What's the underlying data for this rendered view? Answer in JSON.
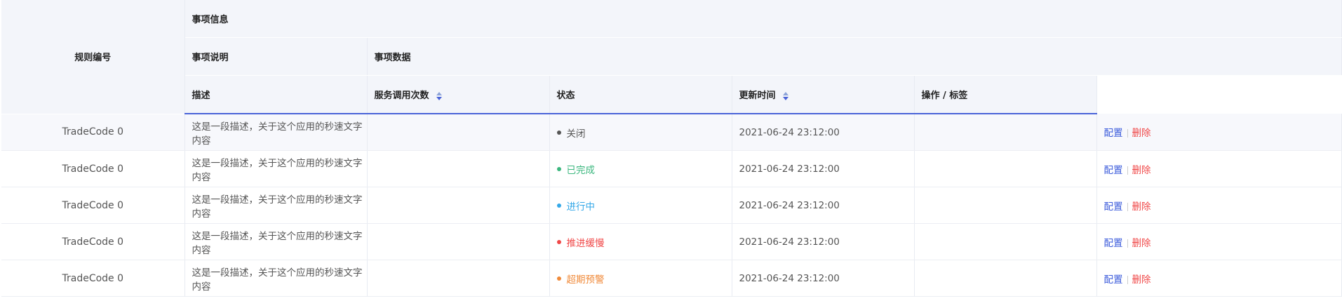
{
  "header": {
    "rule_no": "规则编号",
    "item_info": "事项信息",
    "item_desc_group": "事项说明",
    "item_data_group": "事项数据",
    "desc": "描述",
    "call_count": "服务调用次数",
    "status": "状态",
    "updated_at": "更新时间",
    "actions": "操作 / 标签"
  },
  "colors": {
    "accent": "#4a63d8",
    "link": "#3b5bdb",
    "danger": "#f04848"
  },
  "rows": [
    {
      "code": "TradeCode 0",
      "desc": "这是一段描述，关于这个应用的秒速文字内容",
      "calls": "",
      "status": "关闭",
      "status_color": "#555555",
      "time": "2021-06-24 23:12:00",
      "action_config": "配置",
      "action_delete": "删除"
    },
    {
      "code": "TradeCode 0",
      "desc": "这是一段描述，关于这个应用的秒速文字内容",
      "calls": "",
      "status": "已完成",
      "status_color": "#3bb77e",
      "time": "2021-06-24 23:12:00",
      "action_config": "配置",
      "action_delete": "删除"
    },
    {
      "code": "TradeCode 0",
      "desc": "这是一段描述，关于这个应用的秒速文字内容",
      "calls": "",
      "status": "进行中",
      "status_color": "#35a8e8",
      "time": "2021-06-24 23:12:00",
      "action_config": "配置",
      "action_delete": "删除"
    },
    {
      "code": "TradeCode 0",
      "desc": "这是一段描述，关于这个应用的秒速文字内容",
      "calls": "",
      "status": "推进缓慢",
      "status_color": "#f04848",
      "time": "2021-06-24 23:12:00",
      "action_config": "配置",
      "action_delete": "删除"
    },
    {
      "code": "TradeCode 0",
      "desc": "这是一段描述，关于这个应用的秒速文字内容",
      "calls": "",
      "status": "超期预警",
      "status_color": "#f08a3a",
      "time": "2021-06-24 23:12:00",
      "action_config": "配置",
      "action_delete": "删除"
    }
  ]
}
